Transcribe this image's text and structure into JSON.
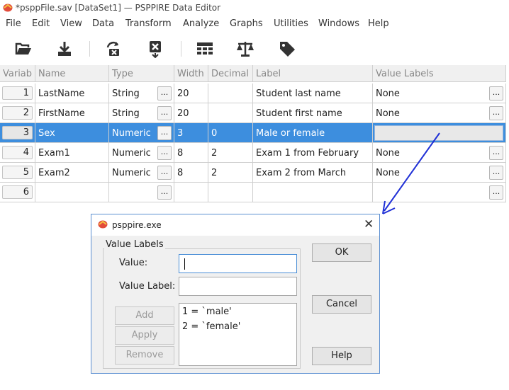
{
  "window": {
    "title": "*psppFile.sav [DataSet1] — PSPPIRE Data Editor"
  },
  "menu": [
    "File",
    "Edit",
    "View",
    "Data",
    "Transform",
    "Analyze",
    "Graphs",
    "Utilities",
    "Windows",
    "Help"
  ],
  "toolbar": {
    "icons": [
      "open-file-icon",
      "save-icon",
      "goto-case-icon",
      "delete-icon",
      "insert-cases-icon",
      "weights-icon",
      "value-labels-icon"
    ]
  },
  "grid": {
    "headers": [
      "Variab",
      "Name",
      "Type",
      "Width",
      "Decimal",
      "Label",
      "Value Labels"
    ],
    "rows": [
      {
        "num": "1",
        "name": "LastName",
        "type": "String",
        "width": "20",
        "decimals": "",
        "label": "Student last name",
        "value_labels": "None"
      },
      {
        "num": "2",
        "name": "FirstName",
        "type": "String",
        "width": "20",
        "decimals": "",
        "label": "Student first name",
        "value_labels": "None"
      },
      {
        "num": "3",
        "name": "Sex",
        "type": "Numeric",
        "width": "3",
        "decimals": "0",
        "label": "Male or female",
        "value_labels": ""
      },
      {
        "num": "4",
        "name": "Exam1",
        "type": "Numeric",
        "width": "8",
        "decimals": "2",
        "label": "Exam 1 from February",
        "value_labels": "None"
      },
      {
        "num": "5",
        "name": "Exam2",
        "type": "Numeric",
        "width": "8",
        "decimals": "2",
        "label": "Exam 2 from March",
        "value_labels": "None"
      },
      {
        "num": "6",
        "name": "",
        "type": "",
        "width": "",
        "decimals": "",
        "label": "",
        "value_labels": ""
      }
    ],
    "ellipsis": "..."
  },
  "dialog": {
    "title": "psppire.exe",
    "group_label": "Value Labels",
    "value_label": "Value:",
    "value_label_label": "Value Label:",
    "value_input": "",
    "value_label_input": "",
    "list": [
      "1 = `male'",
      "2 = `female'"
    ],
    "buttons": {
      "add": "Add",
      "apply": "Apply",
      "remove": "Remove",
      "ok": "OK",
      "cancel": "Cancel",
      "help": "Help"
    }
  },
  "colors": {
    "selection": "#3d8ede",
    "annotation_arrow": "#1f2fd6"
  }
}
